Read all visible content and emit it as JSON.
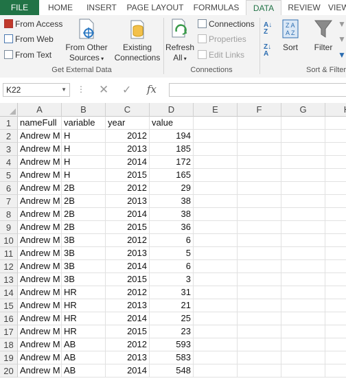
{
  "tabs": [
    "FILE",
    "HOME",
    "INSERT",
    "PAGE LAYOUT",
    "FORMULAS",
    "DATA",
    "REVIEW",
    "VIEW"
  ],
  "ribbon": {
    "ext": {
      "from_access": "From Access",
      "from_web": "From Web",
      "from_text": "From Text",
      "other_1": "From Other",
      "other_2": "Sources",
      "existing_1": "Existing",
      "existing_2": "Connections",
      "group": "Get External Data"
    },
    "conn": {
      "refresh_1": "Refresh",
      "refresh_2": "All",
      "connections": "Connections",
      "properties": "Properties",
      "edit_links": "Edit Links",
      "group": "Connections"
    },
    "sort": {
      "sort": "Sort",
      "filter": "Filter",
      "group": "Sort & Filter"
    }
  },
  "formula_bar": {
    "name_box": "K22",
    "formula": ""
  },
  "columns": [
    "A",
    "B",
    "C",
    "D",
    "E",
    "F",
    "G",
    "H"
  ],
  "rows": [
    [
      "nameFull",
      "variable",
      "year",
      "value"
    ],
    [
      "Andrew M",
      "H",
      "2012",
      "194"
    ],
    [
      "Andrew M",
      "H",
      "2013",
      "185"
    ],
    [
      "Andrew M",
      "H",
      "2014",
      "172"
    ],
    [
      "Andrew M",
      "H",
      "2015",
      "165"
    ],
    [
      "Andrew M",
      "2B",
      "2012",
      "29"
    ],
    [
      "Andrew M",
      "2B",
      "2013",
      "38"
    ],
    [
      "Andrew M",
      "2B",
      "2014",
      "38"
    ],
    [
      "Andrew M",
      "2B",
      "2015",
      "36"
    ],
    [
      "Andrew M",
      "3B",
      "2012",
      "6"
    ],
    [
      "Andrew M",
      "3B",
      "2013",
      "5"
    ],
    [
      "Andrew M",
      "3B",
      "2014",
      "6"
    ],
    [
      "Andrew M",
      "3B",
      "2015",
      "3"
    ],
    [
      "Andrew M",
      "HR",
      "2012",
      "31"
    ],
    [
      "Andrew M",
      "HR",
      "2013",
      "21"
    ],
    [
      "Andrew M",
      "HR",
      "2014",
      "25"
    ],
    [
      "Andrew M",
      "HR",
      "2015",
      "23"
    ],
    [
      "Andrew M",
      "AB",
      "2012",
      "593"
    ],
    [
      "Andrew M",
      "AB",
      "2013",
      "583"
    ],
    [
      "Andrew M",
      "AB",
      "2014",
      "548"
    ]
  ],
  "colors": {
    "excel_green": "#217346",
    "ribbon_bg": "#f3f3f3"
  }
}
